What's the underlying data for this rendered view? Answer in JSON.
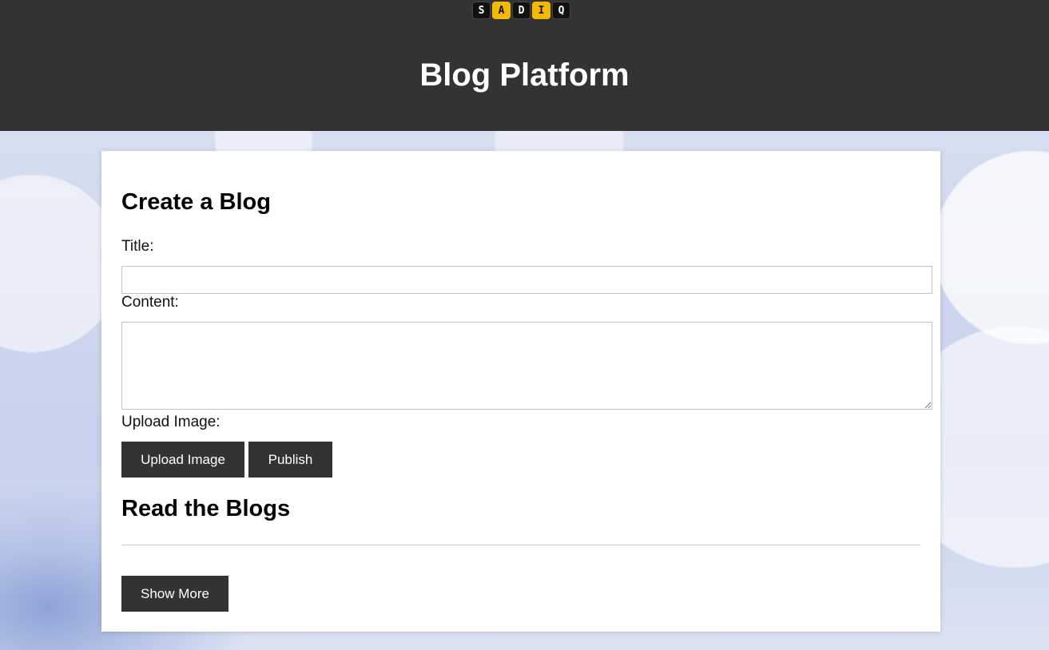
{
  "header": {
    "logo_letters": [
      "S",
      "A",
      "D",
      "I",
      "Q"
    ],
    "title": "Blog Platform"
  },
  "create": {
    "heading": "Create a Blog",
    "title_label": "Title:",
    "title_value": "",
    "content_label": "Content:",
    "content_value": "",
    "upload_label": "Upload Image:",
    "upload_button": "Upload Image",
    "publish_button": "Publish"
  },
  "read": {
    "heading": "Read the Blogs",
    "show_more_button": "Show More"
  },
  "colors": {
    "header_bg": "#333333",
    "button_bg": "#333333",
    "logo_accent": "#f5b800"
  }
}
